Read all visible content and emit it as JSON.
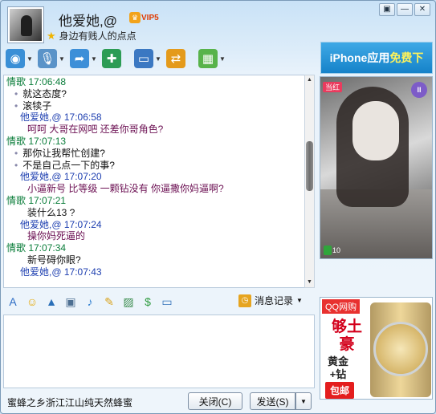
{
  "header": {
    "contact_name": "他爱她,@",
    "vip_label": "VIP5",
    "signature": "身边有贱人的点点",
    "window_buttons": [
      "▣",
      "—",
      "✕"
    ]
  },
  "toolbar": {
    "items": [
      {
        "icon": "video-call-icon",
        "color": "#3a8fd6",
        "glyph": "◉",
        "has_arrow": true
      },
      {
        "icon": "voice-call-icon",
        "color": "#5a93c8",
        "glyph": "🎙",
        "has_arrow": true
      },
      {
        "icon": "file-transfer-icon",
        "color": "#3d8fd8",
        "glyph": "➦",
        "has_arrow": true
      },
      {
        "icon": "new-message-icon",
        "color": "#2c9c55",
        "glyph": "✚",
        "has_arrow": false
      },
      {
        "icon": "remote-desktop-icon",
        "color": "#3b78c2",
        "glyph": "▭",
        "has_arrow": true
      },
      {
        "icon": "share-screen-icon",
        "color": "#e49a1b",
        "glyph": "⇄",
        "has_arrow": false
      },
      {
        "icon": "apps-icon",
        "color": "#58b34b",
        "glyph": "▦",
        "has_arrow": true
      }
    ]
  },
  "ads": {
    "iphone_text": "iPhone应用",
    "iphone_highlight": "免费下",
    "qq_tag": "QQ网购",
    "qq_big": "够土豪",
    "qq_small": "黄金+钻",
    "qq_cta": "包邮"
  },
  "photo": {
    "badge": "当红",
    "pause": "II",
    "likes": "10"
  },
  "chat": {
    "messages": [
      {
        "kind": "sender-them",
        "text": "情歌   17:06:48"
      },
      {
        "kind": "body-them",
        "text": "就这态度?"
      },
      {
        "kind": "body-them",
        "text": "滚犊子"
      },
      {
        "kind": "sender-me",
        "text": "他爱她,@   17:06:58"
      },
      {
        "kind": "body-me",
        "text": "呵呵  大哥在网吧  还差你哥角色?"
      },
      {
        "kind": "sender-them",
        "text": "情歌   17:07:13"
      },
      {
        "kind": "body-them",
        "text": "那你让我帮忙创建?"
      },
      {
        "kind": "body-them",
        "text": "不是自己点一下的事?"
      },
      {
        "kind": "sender-me",
        "text": "他爱她,@   17:07:20"
      },
      {
        "kind": "body-me",
        "text": "小逼新号   比等级  一颗钻没有  你逼撒你妈逼啊?"
      },
      {
        "kind": "sender-them",
        "text": "情歌   17:07:21"
      },
      {
        "kind": "body-plain",
        "text": "装什么13  ?"
      },
      {
        "kind": "sender-me",
        "text": "他爱她,@   17:07:24"
      },
      {
        "kind": "body-me",
        "text": "操你妈死逼的"
      },
      {
        "kind": "sender-them",
        "text": "情歌   17:07:34"
      },
      {
        "kind": "body-plain",
        "text": "新号碍你眼?"
      },
      {
        "kind": "sender-me",
        "text": "他爱她,@   17:07:43"
      }
    ]
  },
  "input_toolbar": {
    "icons": [
      {
        "name": "font-icon",
        "glyph": "A",
        "color": "#2b6cc4"
      },
      {
        "name": "emoji-icon",
        "glyph": "☺",
        "color": "#e5a600"
      },
      {
        "name": "shake-icon",
        "glyph": "▲",
        "color": "#2a6fb8"
      },
      {
        "name": "video-message-icon",
        "glyph": "▣",
        "color": "#4d6f92"
      },
      {
        "name": "voice-message-icon",
        "glyph": "♪",
        "color": "#2f7ed0"
      },
      {
        "name": "handwriting-icon",
        "glyph": "✎",
        "color": "#d9a21b"
      },
      {
        "name": "screenshot-icon",
        "glyph": "▨",
        "color": "#3c8d4f"
      },
      {
        "name": "music-icon",
        "glyph": "$",
        "color": "#2e9b3f"
      },
      {
        "name": "screen-capture-icon",
        "glyph": "▭",
        "color": "#2f6fb8"
      }
    ],
    "message_record": "消息记录"
  },
  "footer": {
    "status": "蜜蜂之乡浙江江山纯天然蜂蜜",
    "close_label": "关闭(C)",
    "send_label": "发送(S)"
  }
}
